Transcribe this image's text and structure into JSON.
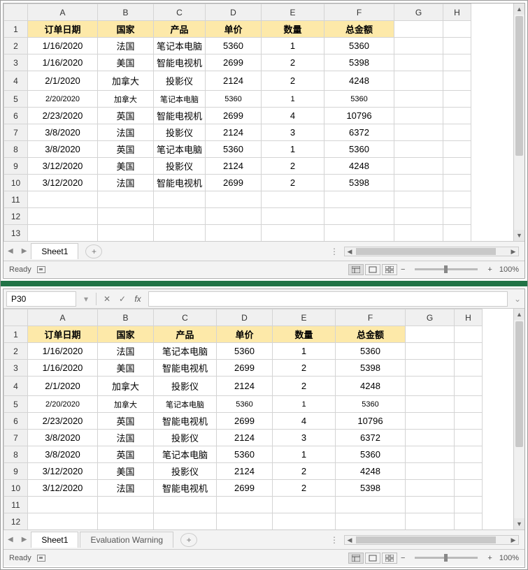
{
  "columns": [
    "A",
    "B",
    "C",
    "D",
    "E",
    "F",
    "G",
    "H"
  ],
  "headers": {
    "a": "订单日期",
    "b": "国家",
    "c": "产品",
    "d": "单价",
    "e": "数量",
    "f": "总金额"
  },
  "rows": [
    {
      "a": "1/16/2020",
      "b": "法国",
      "c": "笔记本电脑",
      "d": "5360",
      "e": "1",
      "f": "5360"
    },
    {
      "a": "1/16/2020",
      "b": "美国",
      "c": "智能电视机",
      "d": "2699",
      "e": "2",
      "f": "5398"
    },
    {
      "a": "2/1/2020",
      "b": "加拿大",
      "c": "投影仪",
      "d": "2124",
      "e": "2",
      "f": "4248"
    },
    {
      "a": "2/20/2020",
      "b": "加拿大",
      "c": "笔记本电脑",
      "d": "5360",
      "e": "1",
      "f": "5360"
    },
    {
      "a": "2/23/2020",
      "b": "英国",
      "c": "智能电视机",
      "d": "2699",
      "e": "4",
      "f": "10796"
    },
    {
      "a": "3/8/2020",
      "b": "法国",
      "c": "投影仪",
      "d": "2124",
      "e": "3",
      "f": "6372"
    },
    {
      "a": "3/8/2020",
      "b": "英国",
      "c": "笔记本电脑",
      "d": "5360",
      "e": "1",
      "f": "5360"
    },
    {
      "a": "3/12/2020",
      "b": "美国",
      "c": "投影仪",
      "d": "2124",
      "e": "2",
      "f": "4248"
    },
    {
      "a": "3/12/2020",
      "b": "法国",
      "c": "智能电视机",
      "d": "2699",
      "e": "2",
      "f": "5398"
    }
  ],
  "pane1": {
    "c_clipped": [
      "笔记本电脑",
      "智能电视机",
      "投影仪",
      "笔记本电脑",
      "智能电视机",
      "投影仪",
      "笔记本电脑",
      "投影仪",
      "智能电视机"
    ]
  },
  "sheet1": "Sheet1",
  "sheet2": "Evaluation Warning",
  "namebox": "P30",
  "fx": "fx",
  "ready": "Ready",
  "zoom": "100%",
  "plus": "+",
  "minus": "−"
}
